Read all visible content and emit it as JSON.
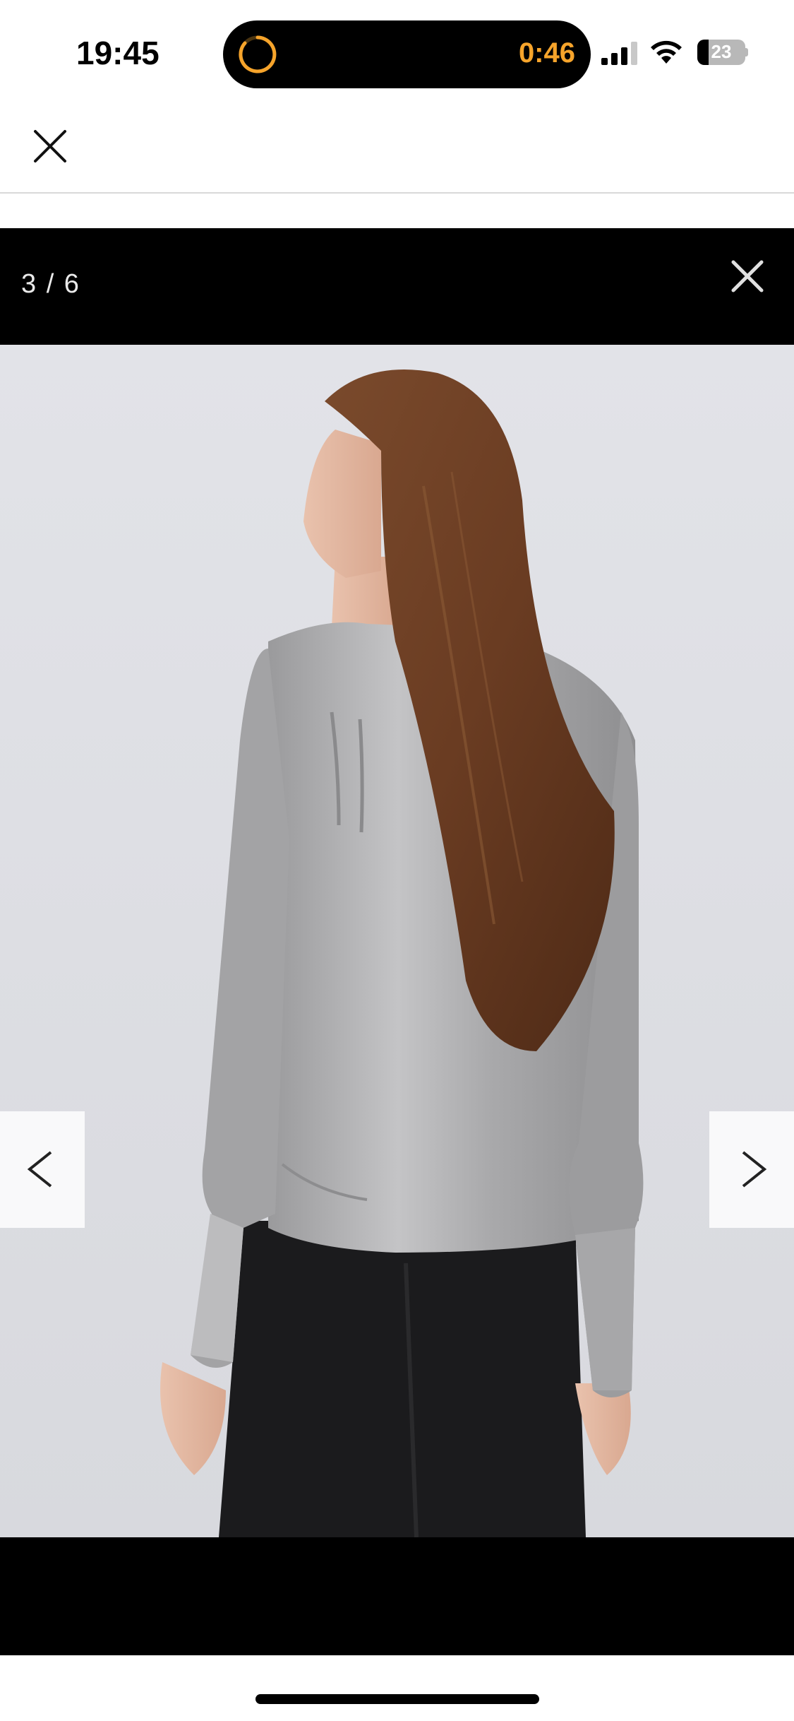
{
  "status_bar": {
    "time": "19:45",
    "timer": "0:46",
    "battery_level": "23",
    "accent_color": "#f6a42b",
    "icons": [
      "timer-icon",
      "signal-icon",
      "wifi-icon",
      "battery-icon"
    ]
  },
  "top_bar": {
    "close_icon": "close-icon"
  },
  "gallery": {
    "counter": "3 / 6",
    "close_icon": "close-icon",
    "prev_icon": "chevron-left-icon",
    "next_icon": "chevron-right-icon",
    "background_color": "#000000"
  }
}
